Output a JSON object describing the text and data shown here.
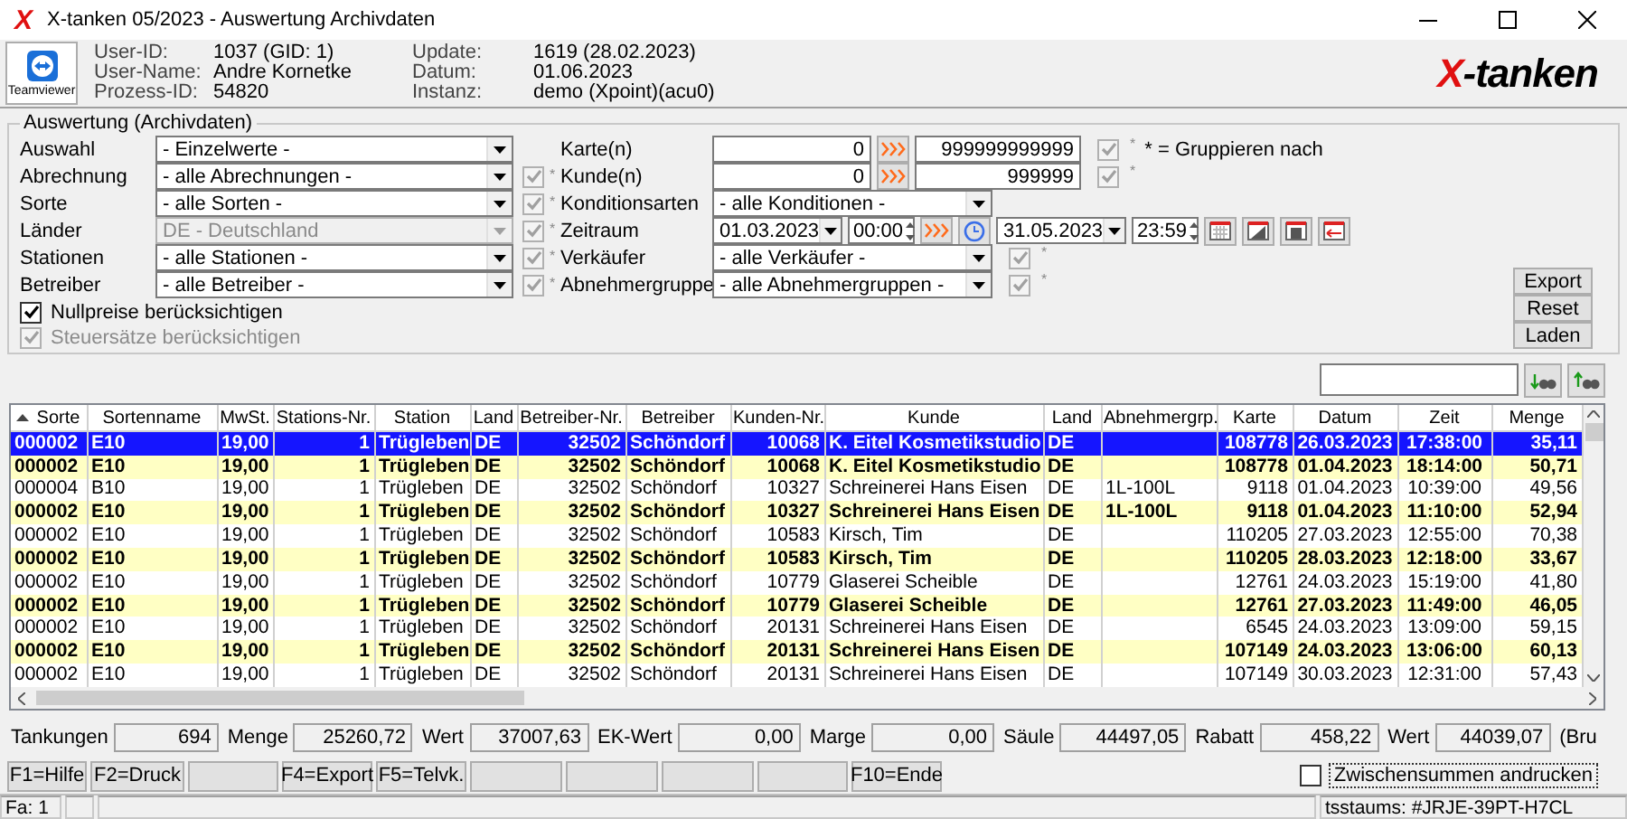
{
  "window": {
    "icon": "X",
    "title": "X-tanken 05/2023 - Auswertung Archivdaten"
  },
  "header": {
    "remote_label": "Teamviewer",
    "info": [
      {
        "label": "User-ID:",
        "value": "1037 (GID: 1)"
      },
      {
        "label": "Update:",
        "value": "1619 (28.02.2023)"
      },
      {
        "label": "User-Name:",
        "value": "Andre Kornetke"
      },
      {
        "label": "Datum:",
        "value": "01.06.2023"
      },
      {
        "label": "Prozess-ID:",
        "value": "54820"
      },
      {
        "label": "Instanz:",
        "value": "demo (Xpoint)(acu0)"
      }
    ],
    "logo": "X-tanken"
  },
  "filter_group": {
    "title": "Auswertung (Archivdaten)",
    "left": [
      {
        "label": "Auswahl",
        "value": "- Einzelwerte -",
        "disabled": false
      },
      {
        "label": "Abrechnung",
        "value": "- alle Abrechnungen -",
        "disabled": false,
        "group": {
          "checked": true,
          "mark": "*"
        }
      },
      {
        "label": "Sorte",
        "value": "- alle Sorten -",
        "disabled": false,
        "group": {
          "checked": true,
          "mark": "*"
        }
      },
      {
        "label": "Länder",
        "value": "DE - Deutschland",
        "disabled": true,
        "group": {
          "checked": true,
          "mark": "*"
        }
      },
      {
        "label": "Stationen",
        "value": "- alle Stationen -",
        "disabled": false,
        "group": {
          "checked": true,
          "mark": "*"
        }
      },
      {
        "label": "Betreiber",
        "value": "- alle Betreiber -",
        "disabled": false,
        "group": {
          "checked": true,
          "mark": "*"
        }
      }
    ],
    "right": [
      {
        "kind": "range",
        "label": "Karte(n)",
        "from": "0",
        "to": "999999999999",
        "group": {
          "checked": true,
          "mark": "*"
        },
        "note": "* = Gruppieren nach"
      },
      {
        "kind": "range",
        "label": "Kunde(n)",
        "from": "0",
        "to": "999999",
        "group": {
          "checked": true,
          "mark": "*"
        }
      },
      {
        "kind": "select",
        "label": "Konditionsarten",
        "value": "- alle Konditionen -"
      },
      {
        "kind": "period",
        "label": "Zeitraum",
        "from_date": "01.03.2023",
        "from_time": "00:00",
        "to_date": "31.05.2023",
        "to_time": "23:59"
      },
      {
        "kind": "select",
        "label": "Verkäufer",
        "value": "- alle Verkäufer -",
        "group": {
          "checked": true,
          "mark": "*"
        }
      },
      {
        "kind": "select",
        "label": "Abnehmergruppe",
        "value": "- alle Abnehmergruppen -",
        "group": {
          "checked": true,
          "mark": "*"
        }
      }
    ],
    "options": [
      {
        "label": "Nullpreise berücksichtigen",
        "checked": true,
        "disabled": false
      },
      {
        "label": "Steuersätze berücksichtigen",
        "checked": true,
        "disabled": true
      }
    ],
    "buttons": [
      "Export",
      "Reset",
      "Laden"
    ]
  },
  "table": {
    "columns": [
      "Sorte",
      "Sortenname",
      "MwSt.",
      "Stations-Nr.",
      "Station",
      "Land",
      "Betreiber-Nr.",
      "Betreiber",
      "Kunden-Nr.",
      "Kunde",
      "Land",
      "Abnehmergrp.",
      "Karte",
      "Datum",
      "Zeit",
      "Menge"
    ],
    "rows": [
      {
        "selected": true,
        "marked": false,
        "cells": [
          "000002",
          "E10",
          "19,00",
          "1",
          "Trügleben",
          "DE",
          "32502",
          "Schöndorf",
          "10068",
          "K. Eitel Kosmetikstudio",
          "DE",
          null,
          "108778",
          "26.03.2023",
          "17:38:00",
          "35,11"
        ]
      },
      {
        "selected": false,
        "marked": true,
        "cells": [
          "000002",
          "E10",
          "19,00",
          "1",
          "Trügleben",
          "DE",
          "32502",
          "Schöndorf",
          "10068",
          "K. Eitel Kosmetikstudio",
          "DE",
          null,
          "108778",
          "01.04.2023",
          "18:14:00",
          "50,71"
        ]
      },
      {
        "selected": false,
        "marked": false,
        "cells": [
          "000004",
          "B10",
          "19,00",
          "1",
          "Trügleben",
          "DE",
          "32502",
          "Schöndorf",
          "10327",
          "Schreinerei Hans Eisen",
          "DE",
          "1L-100L",
          "9118",
          "01.04.2023",
          "10:39:00",
          "49,56"
        ]
      },
      {
        "selected": false,
        "marked": true,
        "cells": [
          "000002",
          "E10",
          "19,00",
          "1",
          "Trügleben",
          "DE",
          "32502",
          "Schöndorf",
          "10327",
          "Schreinerei Hans Eisen",
          "DE",
          "1L-100L",
          "9118",
          "01.04.2023",
          "11:10:00",
          "52,94"
        ]
      },
      {
        "selected": false,
        "marked": false,
        "cells": [
          "000002",
          "E10",
          "19,00",
          "1",
          "Trügleben",
          "DE",
          "32502",
          "Schöndorf",
          "10583",
          "Kirsch, Tim",
          "DE",
          null,
          "110205",
          "27.03.2023",
          "12:55:00",
          "70,38"
        ]
      },
      {
        "selected": false,
        "marked": true,
        "cells": [
          "000002",
          "E10",
          "19,00",
          "1",
          "Trügleben",
          "DE",
          "32502",
          "Schöndorf",
          "10583",
          "Kirsch, Tim",
          "DE",
          null,
          "110205",
          "28.03.2023",
          "12:18:00",
          "33,67"
        ]
      },
      {
        "selected": false,
        "marked": false,
        "cells": [
          "000002",
          "E10",
          "19,00",
          "1",
          "Trügleben",
          "DE",
          "32502",
          "Schöndorf",
          "10779",
          "Glaserei Scheible",
          "DE",
          null,
          "12761",
          "24.03.2023",
          "15:19:00",
          "41,80"
        ]
      },
      {
        "selected": false,
        "marked": true,
        "cells": [
          "000002",
          "E10",
          "19,00",
          "1",
          "Trügleben",
          "DE",
          "32502",
          "Schöndorf",
          "10779",
          "Glaserei Scheible",
          "DE",
          null,
          "12761",
          "27.03.2023",
          "11:49:00",
          "46,05"
        ]
      },
      {
        "selected": false,
        "marked": false,
        "cells": [
          "000002",
          "E10",
          "19,00",
          "1",
          "Trügleben",
          "DE",
          "32502",
          "Schöndorf",
          "20131",
          "Schreinerei Hans Eisen",
          "DE",
          null,
          "6545",
          "24.03.2023",
          "13:09:00",
          "59,15"
        ]
      },
      {
        "selected": false,
        "marked": true,
        "cells": [
          "000002",
          "E10",
          "19,00",
          "1",
          "Trügleben",
          "DE",
          "32502",
          "Schöndorf",
          "20131",
          "Schreinerei Hans Eisen",
          "DE",
          null,
          "107149",
          "24.03.2023",
          "13:06:00",
          "60,13"
        ]
      },
      {
        "selected": false,
        "marked": false,
        "cells": [
          "000002",
          "E10",
          "19,00",
          "1",
          "Trügleben",
          "DE",
          "32502",
          "Schöndorf",
          "20131",
          "Schreinerei Hans Eisen",
          "DE",
          null,
          "107149",
          "30.03.2023",
          "12:31:00",
          "57,43"
        ]
      }
    ]
  },
  "totals": [
    {
      "label": "Tankungen",
      "value": "694"
    },
    {
      "label": "Menge",
      "value": "25260,72"
    },
    {
      "label": "Wert",
      "value": "37007,63"
    },
    {
      "label": "EK-Wert",
      "value": "0,00"
    },
    {
      "label": "Marge",
      "value": "0,00"
    },
    {
      "label": "Säule",
      "value": "44497,05"
    },
    {
      "label": "Rabatt",
      "value": "458,22"
    },
    {
      "label": "Wert",
      "value": "44039,07"
    }
  ],
  "totals_suffix": "(Bru",
  "function_keys": [
    {
      "kind": "key",
      "label": "F1=Hilfe"
    },
    {
      "kind": "key",
      "label": "F2=Druck"
    },
    {
      "kind": "blank"
    },
    {
      "kind": "key",
      "label": "F4=Export"
    },
    {
      "kind": "key",
      "label": "F5=Telvk."
    },
    {
      "kind": "blank"
    },
    {
      "kind": "blank"
    },
    {
      "kind": "blank"
    },
    {
      "kind": "blank"
    },
    {
      "kind": "key",
      "label": "F10=Ende"
    }
  ],
  "print_option": {
    "label": "Zwischensummen andrucken",
    "checked": false
  },
  "status_bar": {
    "company": "Fa: 1",
    "license": "tsstaums: #JRJE-39PT-H7CL"
  }
}
